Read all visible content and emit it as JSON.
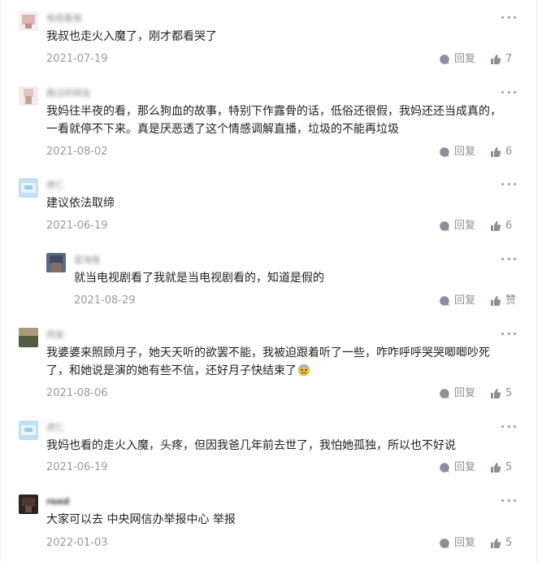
{
  "comments": [
    {
      "nickname": "电视看客",
      "text": "我叔也走火入魔了，刚才都看哭了",
      "date": "2021-07-19",
      "reply_label": "回复",
      "likes": "7"
    },
    {
      "nickname": "路过的网友",
      "text": "我妈往半夜的看，那么狗血的故事，特别下作露骨的话，低俗还很假，我妈还还当成真的，一看就停不下来。真是厌恶透了这个情感调解直播，垃圾的不能再垃圾",
      "date": "2021-08-02",
      "reply_label": "回复",
      "likes": "6"
    },
    {
      "nickname": "虎仁",
      "text": "建议依法取缔",
      "date": "2021-06-19",
      "reply_label": "回复",
      "likes": "6"
    },
    {
      "nickname": "蓝海鱼",
      "text": "就当电视剧看了我就是当电视剧看的，知道是假的",
      "date": "2021-08-29",
      "reply_label": "回复",
      "likes": "赞"
    },
    {
      "nickname": "热饭",
      "text": "我婆婆来照顾月子，她天天听的欲罢不能，我被迫跟着听了一些，咋咋呼呼哭哭唧唧吵死了，和她说是演的她有些不信，还好月子快结束了",
      "date": "2021-08-06",
      "reply_label": "回复",
      "likes": "5"
    },
    {
      "nickname": "虎仁",
      "text": "我妈也看的走火入魔，头疼，但因我爸几年前去世了，我怕她孤独，所以也不好说",
      "date": "2021-06-19",
      "reply_label": "回复",
      "likes": "5"
    },
    {
      "nickname": "reed",
      "text": "大家可以去 中央网信办举报中心 举报",
      "date": "2022-01-03",
      "reply_label": "回复",
      "likes": "5"
    }
  ],
  "icons": {
    "more": "more-dots-icon",
    "reply": "comment-bubble-icon",
    "like": "thumbs-up-icon",
    "emoji": "anxious-sweat-emoji-icon"
  },
  "colors": {
    "text": "#222222",
    "meta": "#9a9a9a",
    "action": "#8a8f99"
  }
}
